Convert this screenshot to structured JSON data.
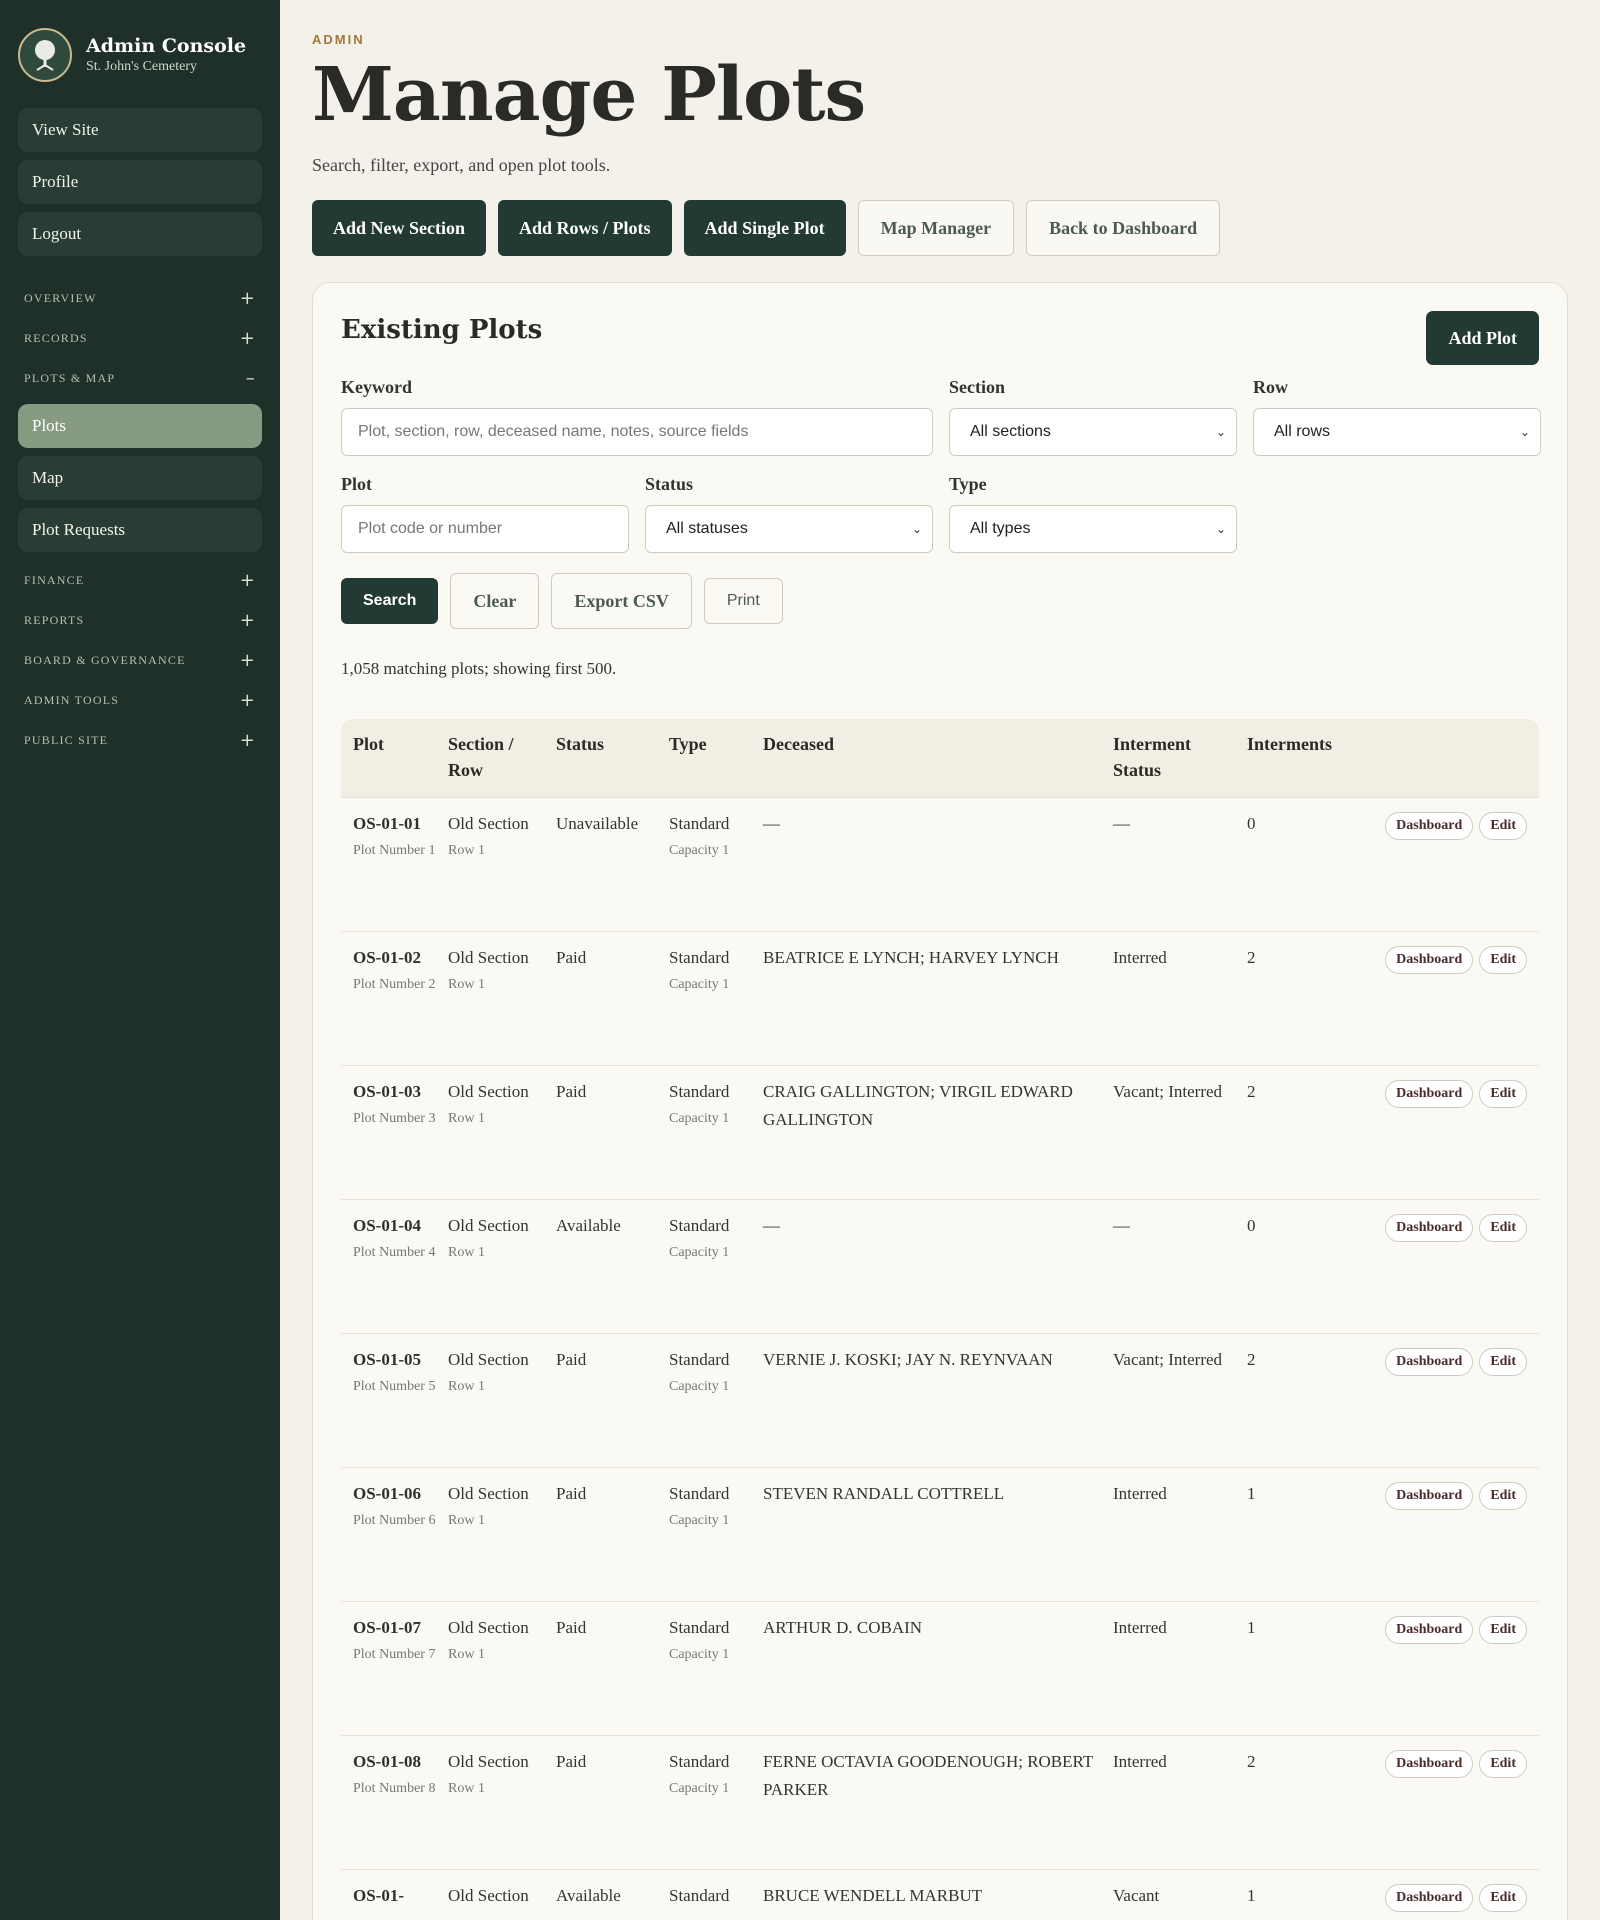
{
  "sidebar": {
    "brand_title": "Admin Console",
    "brand_subtitle": "St. John's Cemetery",
    "top_links": [
      "View Site",
      "Profile",
      "Logout"
    ],
    "groups": [
      {
        "label": "OVERVIEW",
        "sign": "+"
      },
      {
        "label": "RECORDS",
        "sign": "+"
      },
      {
        "label": "PLOTS & MAP",
        "sign": "–"
      }
    ],
    "sub_links": [
      "Plots",
      "Map",
      "Plot Requests"
    ],
    "groups2": [
      {
        "label": "FINANCE",
        "sign": "+"
      },
      {
        "label": "REPORTS",
        "sign": "+"
      },
      {
        "label": "BOARD & GOVERNANCE",
        "sign": "+"
      },
      {
        "label": "ADMIN TOOLS",
        "sign": "+"
      },
      {
        "label": "PUBLIC SITE",
        "sign": "+"
      }
    ]
  },
  "header": {
    "eyebrow": "ADMIN",
    "title": "Manage Plots",
    "subtitle": "Search, filter, export, and open plot tools."
  },
  "actions": [
    "Add New Section",
    "Add Rows / Plots",
    "Add Single Plot",
    "Map Manager",
    "Back to Dashboard"
  ],
  "card": {
    "title": "Existing Plots",
    "add_plot": "Add Plot",
    "filters": {
      "keyword_label": "Keyword",
      "keyword_placeholder": "Plot, section, row, deceased name, notes, source fields",
      "section_label": "Section",
      "section_value": "All sections",
      "row_label": "Row",
      "row_value": "All rows",
      "plot_label": "Plot",
      "plot_placeholder": "Plot code or number",
      "status_label": "Status",
      "status_value": "All statuses",
      "type_label": "Type",
      "type_value": "All types"
    },
    "tools": {
      "search": "Search",
      "clear": "Clear",
      "export": "Export CSV",
      "print": "Print"
    },
    "count": "1,058 matching plots; showing first 500."
  },
  "table": {
    "headers": [
      "Plot",
      "Section / Row",
      "Status",
      "Type",
      "Deceased",
      "Interment Status",
      "Interments"
    ],
    "dashboard_label": "Dashboard",
    "edit_label": "Edit",
    "rows": [
      {
        "code": "OS-01-01",
        "number": "Plot Number 1",
        "section": "Old Section",
        "row": "Row 1",
        "status": "Unavailable",
        "type": "Standard",
        "capacity": "Capacity 1",
        "deceased": "—",
        "interment_status": "—",
        "interments": "0"
      },
      {
        "code": "OS-01-02",
        "number": "Plot Number 2",
        "section": "Old Section",
        "row": "Row 1",
        "status": "Paid",
        "type": "Standard",
        "capacity": "Capacity 1",
        "deceased": "BEATRICE E LYNCH; HARVEY LYNCH",
        "interment_status": "Interred",
        "interments": "2"
      },
      {
        "code": "OS-01-03",
        "number": "Plot Number 3",
        "section": "Old Section",
        "row": "Row 1",
        "status": "Paid",
        "type": "Standard",
        "capacity": "Capacity 1",
        "deceased": "CRAIG GALLINGTON; VIRGIL EDWARD GALLINGTON",
        "interment_status": "Vacant; Interred",
        "interments": "2"
      },
      {
        "code": "OS-01-04",
        "number": "Plot Number 4",
        "section": "Old Section",
        "row": "Row 1",
        "status": "Available",
        "type": "Standard",
        "capacity": "Capacity 1",
        "deceased": "—",
        "interment_status": "—",
        "interments": "0"
      },
      {
        "code": "OS-01-05",
        "number": "Plot Number 5",
        "section": "Old Section",
        "row": "Row 1",
        "status": "Paid",
        "type": "Standard",
        "capacity": "Capacity 1",
        "deceased": "VERNIE J. KOSKI; JAY N. REYNVAAN",
        "interment_status": "Vacant; Interred",
        "interments": "2"
      },
      {
        "code": "OS-01-06",
        "number": "Plot Number 6",
        "section": "Old Section",
        "row": "Row 1",
        "status": "Paid",
        "type": "Standard",
        "capacity": "Capacity 1",
        "deceased": "STEVEN RANDALL COTTRELL",
        "interment_status": "Interred",
        "interments": "1"
      },
      {
        "code": "OS-01-07",
        "number": "Plot Number 7",
        "section": "Old Section",
        "row": "Row 1",
        "status": "Paid",
        "type": "Standard",
        "capacity": "Capacity 1",
        "deceased": "ARTHUR D. COBAIN",
        "interment_status": "Interred",
        "interments": "1"
      },
      {
        "code": "OS-01-08",
        "number": "Plot Number 8",
        "section": "Old Section",
        "row": "Row 1",
        "status": "Paid",
        "type": "Standard",
        "capacity": "Capacity 1",
        "deceased": "FERNE OCTAVIA GOODENOUGH; ROBERT PARKER",
        "interment_status": "Interred",
        "interments": "2"
      },
      {
        "code": "OS-01-",
        "number": "",
        "section": "Old Section",
        "row": "",
        "status": "Available",
        "type": "Standard",
        "capacity": "",
        "deceased": "BRUCE WENDELL MARBUT",
        "interment_status": "Vacant",
        "interments": "1"
      }
    ]
  }
}
